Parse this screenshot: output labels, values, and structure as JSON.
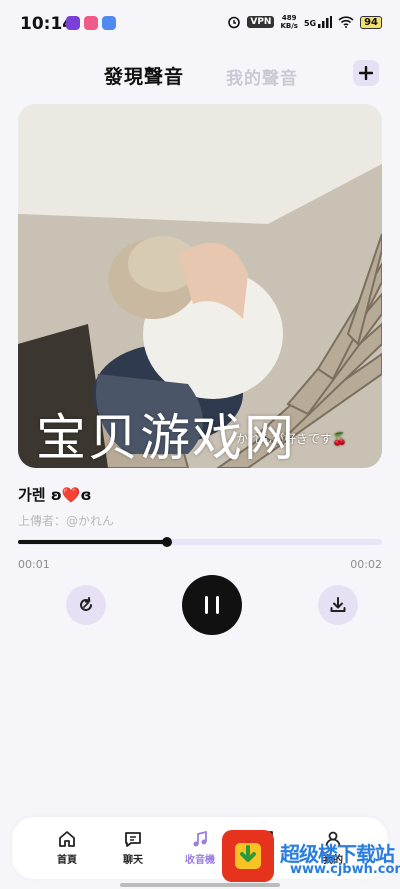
{
  "status_bar": {
    "time": "10:14",
    "vpn": "VPN",
    "net_speed_value": "489",
    "net_speed_unit": "KB/s",
    "signal": "5G",
    "battery": "94"
  },
  "header": {
    "tabs": [
      {
        "label": "發現聲音",
        "active": true
      },
      {
        "label": "我的聲音",
        "active": false
      }
    ],
    "add_icon": "plus-icon"
  },
  "player": {
    "cover_caption": "かれんが好きです🍒",
    "song_title": "가렌 ʚ❤️ɞ",
    "uploader": "上傳者：@かれん",
    "progress": 0.41,
    "time_current": "00:01",
    "time_total": "00:02",
    "controls": {
      "repost_icon": "repost-icon",
      "pause_icon": "pause-icon",
      "download_icon": "download-icon"
    }
  },
  "nav": {
    "items": [
      {
        "label": "首頁",
        "icon": "home-icon",
        "active": false
      },
      {
        "label": "聊天",
        "icon": "chat-icon",
        "active": false
      },
      {
        "label": "收音機",
        "icon": "music-note-icon",
        "active": true
      },
      {
        "label": "",
        "icon": "bookmark-icon",
        "active": false
      },
      {
        "label": "我的",
        "icon": "profile-icon",
        "active": false
      }
    ]
  },
  "watermark": {
    "overlay_text": "宝贝游戏网",
    "site_name": "超级楼下载站",
    "site_url": "www.cjbwh.com"
  },
  "colors": {
    "accent": "#9b7fe0",
    "accent_light": "#e6e0f5",
    "track": "#e9e3f7",
    "background": "#f6f6fa"
  }
}
